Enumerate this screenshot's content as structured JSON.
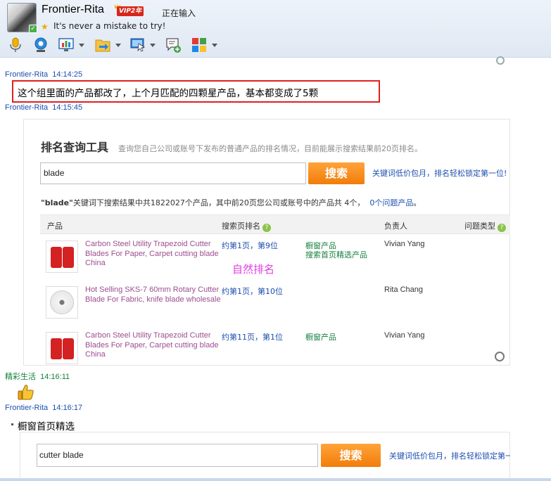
{
  "contact": {
    "name": "Frontier-Rita",
    "vip_label": "VIP2年",
    "status": "正在输入",
    "signature": "It's never a mistake to try!"
  },
  "toolbar": {
    "icons": [
      "microphone-icon",
      "webcam-icon",
      "screen-share-icon",
      "file-transfer-icon",
      "remote-assist-icon",
      "send-message-icon",
      "apps-icon"
    ]
  },
  "messages": [
    {
      "sender": "Frontier-Rita",
      "time": "14:14:25",
      "text": "这个组里面的产品都改了，上个月匹配的四颗星产品，基本都变成了5颗"
    },
    {
      "sender": "Frontier-Rita",
      "time": "14:15:45"
    },
    {
      "sender": "精彩生活",
      "time": "14:16:11"
    },
    {
      "sender": "Frontier-Rita",
      "time": "14:16:17",
      "text": "橱窗首页精选"
    }
  ],
  "rank_tool": {
    "title": "排名查询工具",
    "description": "查询您自己公司或账号下发布的普通产品的排名情况，目前能展示搜索结果前20页排名。",
    "search_value": "blade",
    "search_button": "搜索",
    "promo": "关键词低价包月，排名轻松锁定第一位!",
    "summary_keyword": "\"blade\"",
    "summary_text": "关键词下搜索结果中共1822027个产品，其中前20页您公司或账号中的产品共 4个，",
    "summary_problem_count": "0个",
    "summary_problem_link": "问题产品",
    "summary_end": "。",
    "columns": [
      "产品",
      "搜索页排名",
      "负责人",
      "问题类型"
    ],
    "rows": [
      {
        "product": "Carbon Steel Utility Trapezoid Cutter Blades For Paper, Carpet cutting blade China",
        "rank": "约第1页，第9位",
        "tags": [
          "橱窗产品",
          "搜索首页精选产品"
        ],
        "owner": "Vivian Yang"
      },
      {
        "product": "Hot Selling SKS-7 60mm Rotary Cutter Blade For Fabric, knife blade wholesale",
        "rank": "约第1页，第10位",
        "tags": [],
        "owner": "Rita Chang"
      },
      {
        "product": "Carbon Steel Utility Trapezoid Cutter Blades For Paper, Carpet cutting blade China",
        "rank": "约第11页，第1位",
        "tags": [
          "橱窗产品"
        ],
        "owner": "Vivian Yang"
      }
    ],
    "annotation": "自然排名"
  },
  "second_search": {
    "search_value": "cutter blade",
    "search_button": "搜索",
    "promo": "关键词低价包月，排名轻松锁定第一位!"
  },
  "colors": {
    "sender_blue": "#1c4eb0",
    "sender_green": "#15803d",
    "highlight_red": "#e02020",
    "search_orange": "#f27c0a",
    "product_link": "#9c4d8f"
  }
}
